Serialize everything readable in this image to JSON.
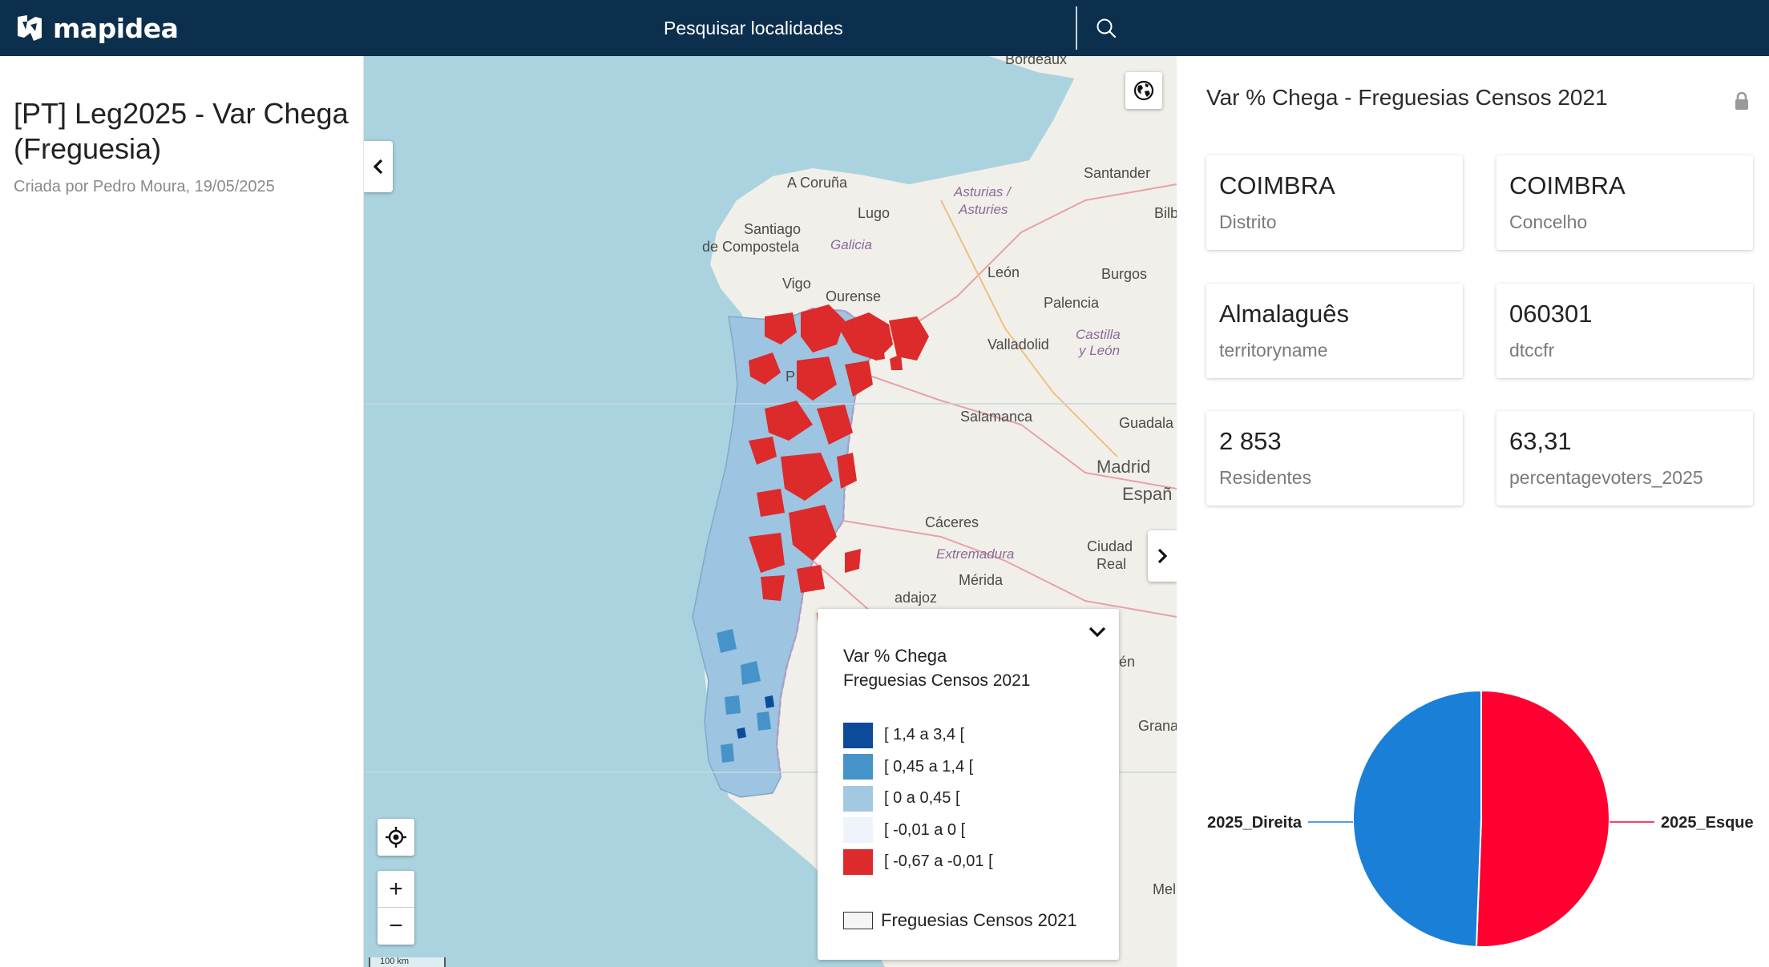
{
  "app": {
    "name": "mapidea",
    "colors": {
      "topbar": "#0c2f4d",
      "accent_red": "#dd2a2a"
    }
  },
  "search": {
    "placeholder": "Pesquisar localidades",
    "icon": "search-icon"
  },
  "map_info": {
    "title": "[PT] Leg2025 - Var Chega (Freguesia)",
    "meta": "Criada por Pedro Moura, 19/05/2025"
  },
  "map": {
    "labels": [
      "Bordeaux",
      "A Coruña",
      "Lugo",
      "Santiago",
      "de Compostela",
      "Galicia",
      "Asturias /",
      "Asturies",
      "Santander",
      "Bilb",
      "Vigo",
      "Ourense",
      "León",
      "Burgos",
      "Palencia",
      "Valladolid",
      "Castilla",
      "y León",
      "Salamanca",
      "Guadala",
      "Madrid",
      "Españ",
      "Cáceres",
      "Extremadura",
      "Ciudad",
      "Real",
      "Mérida",
      "adajoz",
      "én",
      "Grana",
      "Mel",
      "P"
    ],
    "scale": "100 km",
    "controls": {
      "zoom_in": "+",
      "zoom_out": "−"
    }
  },
  "legend": {
    "title": "Var % Chega",
    "subtitle": "Freguesias Censos 2021",
    "items": [
      {
        "label": "[ 1,4 a 3,4 [",
        "color": "#0d4a99"
      },
      {
        "label": "[ 0,45 a 1,4 [",
        "color": "#4593c9"
      },
      {
        "label": "[ 0 a 0,45 [",
        "color": "#a3c8e2"
      },
      {
        "label": "[ -0,01 a 0 [",
        "color": "#eef3fc"
      },
      {
        "label": "[ -0,67 a -0,01 [",
        "color": "#dd2a2a"
      }
    ],
    "layer_label": "Freguesias Censos 2021"
  },
  "panel": {
    "title": "Var % Chega - Freguesias Censos 2021",
    "cards": [
      {
        "value": "COIMBRA",
        "label": "Distrito"
      },
      {
        "value": "COIMBRA",
        "label": "Concelho"
      },
      {
        "value": "Almalaguês",
        "label": "territoryname"
      },
      {
        "value": "060301",
        "label": "dtccfr"
      },
      {
        "value": "2 853",
        "label": "Residentes"
      },
      {
        "value": "63,31",
        "label": "percentagevoters_2025"
      }
    ]
  },
  "chart_data": {
    "type": "pie",
    "slices": [
      {
        "label": "2025_Esque",
        "value": 50.6,
        "color": "#ff0030"
      },
      {
        "label": "2025_Direita",
        "value": 49.4,
        "color": "#1a7fd6"
      }
    ]
  }
}
